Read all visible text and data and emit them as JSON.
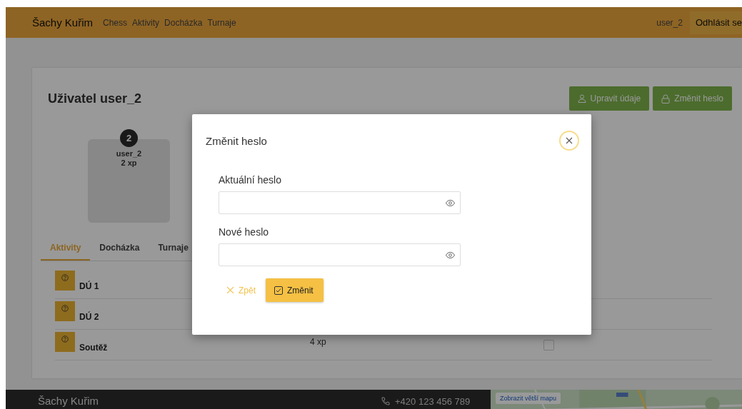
{
  "header": {
    "brand": "Šachy Kuřim",
    "nav": [
      "Chess",
      "Aktivity",
      "Docházka",
      "Turnaje"
    ],
    "user": "user_2",
    "logout": "Odhlásit se"
  },
  "profile": {
    "title": "Uživatel user_2",
    "actions": [
      {
        "label": "Upravit údaje",
        "kind": "edit"
      },
      {
        "label": "Změnit heslo",
        "kind": "password"
      }
    ],
    "player": {
      "rank": "2",
      "name": "user_2",
      "xp": "2 xp"
    },
    "tabs": [
      {
        "label": "Aktivity",
        "selected": true
      },
      {
        "label": "Docházka",
        "selected": false
      },
      {
        "label": "Turnaje",
        "selected": false
      }
    ],
    "activities": [
      {
        "name": "DÚ 1"
      },
      {
        "name": "DÚ 2"
      },
      {
        "name": "Soutěž",
        "xp": "4 xp",
        "checked": false
      }
    ]
  },
  "dialog": {
    "title": "Změnit heslo",
    "fields": [
      {
        "label": "Aktuální heslo"
      },
      {
        "label": "Nové heslo"
      }
    ],
    "cancel": "Zpět",
    "submit": "Změnit"
  },
  "footer": {
    "brand": "Šachy Kuřim",
    "phone": "+420 123 456 789",
    "map_link": "Zobrazit větší mapu"
  }
}
